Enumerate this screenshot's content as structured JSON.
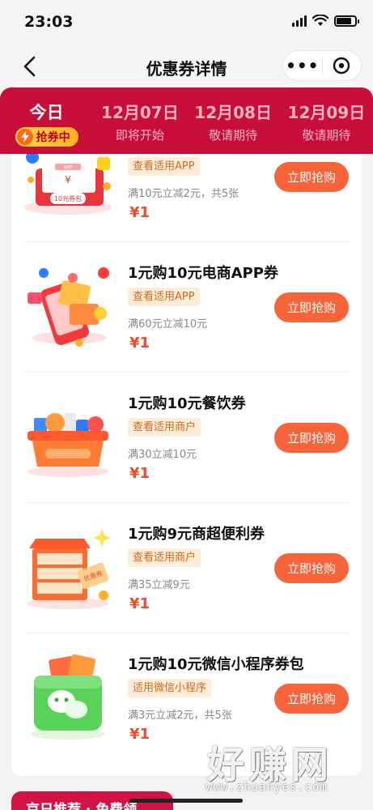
{
  "status_bar": {
    "time": "23:03"
  },
  "nav": {
    "title": "优惠券详情",
    "more_label": "•••"
  },
  "tabs": [
    {
      "date": "今日",
      "status": "抢券中"
    },
    {
      "date": "12月07日",
      "status": "即将开始"
    },
    {
      "date": "12月08日",
      "status": "敬请期待"
    },
    {
      "date": "12月09日",
      "status": "敬请期待"
    }
  ],
  "coupons": [
    {
      "title": "",
      "tag": "查看适用APP",
      "desc": "满10元立减2元，共5张",
      "price": "¥1",
      "button": "立即抢购",
      "image_text": "10元券包",
      "image_sub": "APP"
    },
    {
      "title": "1元购10元电商APP券",
      "tag": "查看适用APP",
      "desc": "满60元立减10元",
      "price": "¥1",
      "button": "立即抢购"
    },
    {
      "title": "1元购10元餐饮券",
      "tag": "查看适用商户",
      "desc": "满30立减10元",
      "price": "¥1",
      "button": "立即抢购"
    },
    {
      "title": "1元购9元商超便利券",
      "tag": "查看适用商户",
      "desc": "满35立减9元",
      "price": "¥1",
      "button": "立即抢购",
      "image_text": "优惠券"
    },
    {
      "title": "1元购10元微信小程序券包",
      "tag": "适用微信小程序",
      "desc": "满3元立减2元，共5张",
      "price": "¥1",
      "button": "立即抢购"
    }
  ],
  "bottom_banner": {
    "label": "京日推荐 · 免费领"
  },
  "watermark": {
    "main": "好赚网",
    "url": "www.zhuanyes.com"
  },
  "colors": {
    "accent": "#c80f3a",
    "button": "#f8643a",
    "price": "#ef4a2c",
    "tag_bg": "#fdecd7"
  }
}
